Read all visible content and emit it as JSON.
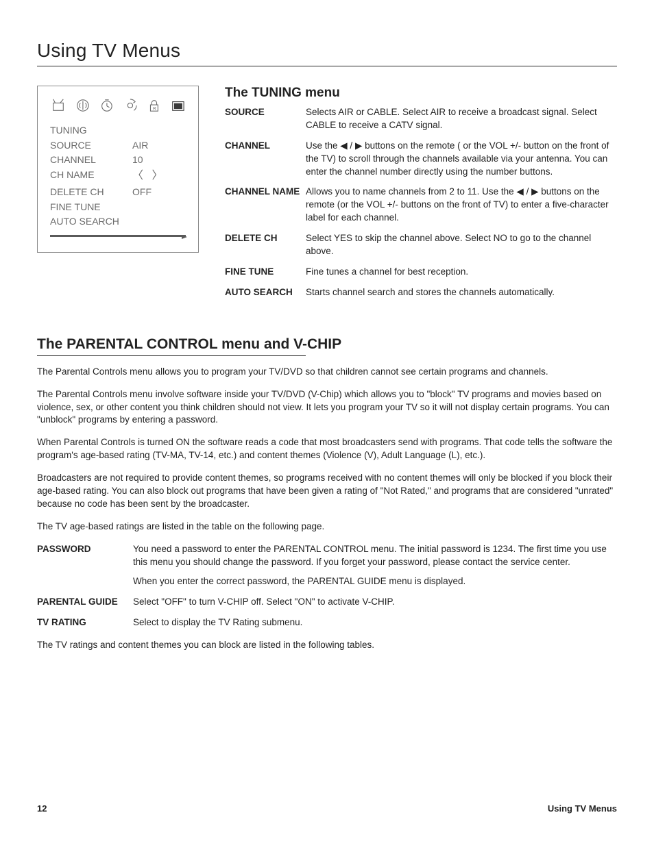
{
  "title": "Using TV Menus",
  "screenshot_menu": {
    "header": "TUNING",
    "items": [
      {
        "label": "SOURCE",
        "value": "AIR"
      },
      {
        "label": "CHANNEL",
        "value": "10"
      },
      {
        "label": "CH NAME",
        "value": "arrows"
      },
      {
        "label": "DELETE   CH",
        "value": "OFF"
      },
      {
        "label": "FINE TUNE",
        "value": ""
      },
      {
        "label": "AUTO SEARCH",
        "value": ""
      }
    ]
  },
  "tuning": {
    "heading": "The TUNING menu",
    "rows": {
      "source": {
        "label": "SOURCE",
        "body": "Selects AIR or CABLE. Select AIR to receive a broadcast signal. Select CABLE to receive a CATV signal."
      },
      "channel": {
        "label": "CHANNEL",
        "pre": "Use the ",
        "post": " buttons on the remote ( or the VOL +/- button on the front of the TV) to scroll through the channels available via your antenna. You can enter the channel number directly using the number buttons."
      },
      "channel_name": {
        "label": "CHANNEL NAME",
        "pre": "Allows you to name channels from 2 to 11. Use the ",
        "post": " buttons on the remote (or the VOL +/- buttons on the front of TV) to enter a five-character label for each channel."
      },
      "delete_ch": {
        "label": "DELETE CH",
        "body": "Select YES to skip the channel above. Select NO to go to the channel above."
      },
      "fine_tune": {
        "label": "FINE TUNE",
        "body": "Fine tunes a channel for best reception."
      },
      "auto_search": {
        "label": "AUTO SEARCH",
        "body": "Starts channel search and stores the channels automatically."
      }
    }
  },
  "parental": {
    "heading": "The PARENTAL CONTROL menu and V-CHIP",
    "p1": "The Parental Controls menu allows you to program your TV/DVD so that children cannot see certain programs and channels.",
    "p2": "The Parental Controls menu involve software inside your TV/DVD (V-Chip) which allows you to \"block\" TV programs and movies based on violence, sex, or other content you think children should not view. It lets you program your TV so it will not display certain programs. You can \"unblock\" programs by entering a password.",
    "p3": "When Parental Controls is turned ON the software reads a code that most broadcasters send with programs. That code tells the software the program's age-based rating (TV-MA, TV-14, etc.) and content themes (Violence (V), Adult Language (L), etc.).",
    "p4": "Broadcasters are not required to provide content themes, so programs received with no content themes will only be blocked if you block their age-based rating. You can also block out programs that have been given a rating of \"Not Rated,\" and programs that are considered \"unrated\" because no code has been sent by the broadcaster.",
    "p5": "The TV age-based ratings are listed in the table on the following page.",
    "rows": {
      "password": {
        "label": "PASSWORD",
        "body1": "You need a password to enter the PARENTAL CONTROL menu. The initial password is 1234. The first time you use this menu you should change the password. If you forget your password, please contact the service center.",
        "body2": "When you enter the correct password, the PARENTAL GUIDE menu is displayed."
      },
      "parental_guide": {
        "label": "PARENTAL GUIDE",
        "body": "Select \"OFF\" to turn V-CHIP off. Select \"ON\" to activate V-CHIP."
      },
      "tv_rating": {
        "label": "TV RATING",
        "body": "Select to display the TV Rating submenu."
      }
    },
    "p6": "The TV ratings and content themes you can block are listed in the following tables."
  },
  "footer": {
    "page": "12",
    "section": "Using TV Menus"
  }
}
